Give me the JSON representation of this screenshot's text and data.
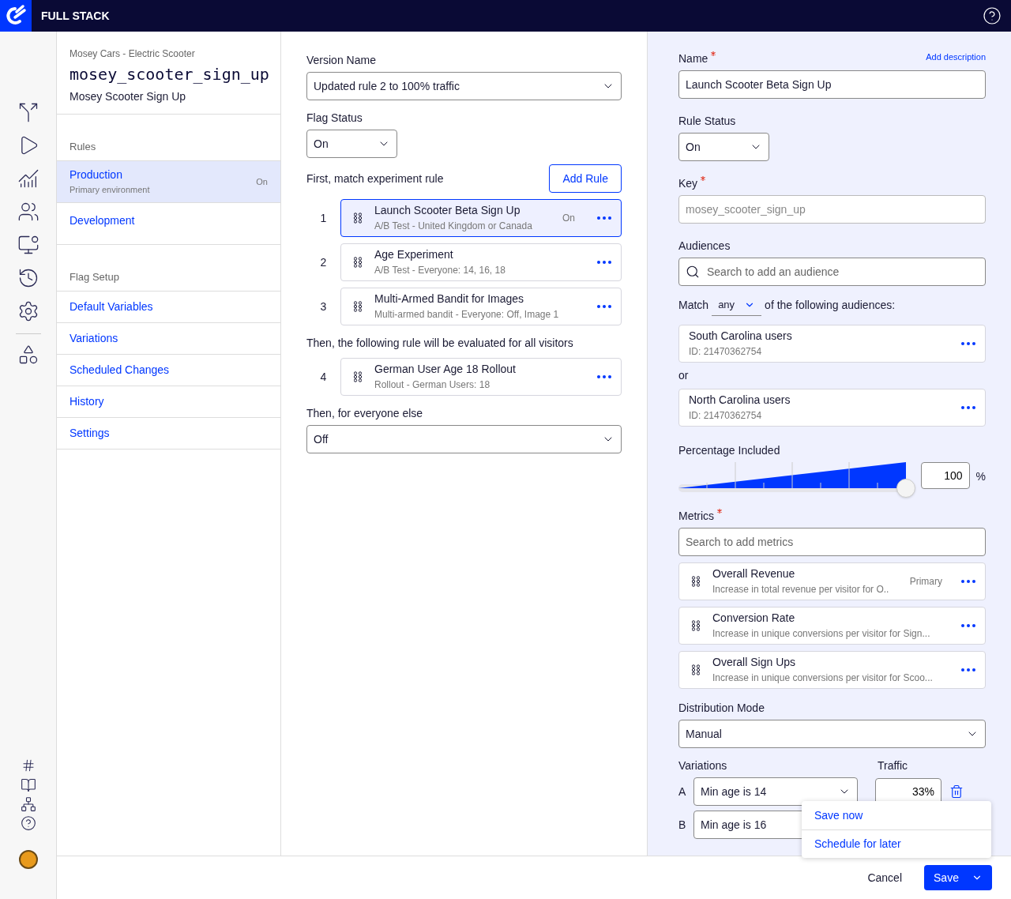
{
  "header": {
    "product": "FULL STACK"
  },
  "flag": {
    "project": "Mosey Cars - Electric Scooter",
    "key": "mosey_scooter_sign_up",
    "name": "Mosey Scooter Sign Up"
  },
  "sidebar": {
    "sections": [
      {
        "heading": "Rules",
        "items": [
          {
            "label": "Production",
            "sub": "Primary environment",
            "status": "On",
            "selected": true
          },
          {
            "label": "Development",
            "selected": false
          }
        ]
      },
      {
        "heading": "Flag Setup",
        "items": [
          {
            "label": "Default Variables",
            "selected": false
          },
          {
            "label": "Variations",
            "selected": false
          },
          {
            "label": "Scheduled Changes",
            "selected": false
          },
          {
            "label": "History",
            "selected": false
          },
          {
            "label": "Settings",
            "selected": false
          }
        ]
      }
    ]
  },
  "middle": {
    "version_name": {
      "label": "Version Name",
      "value": "Updated rule 2 to 100% traffic"
    },
    "flag_status": {
      "label": "Flag Status",
      "value": "On"
    },
    "first_match": {
      "label": "First, match experiment rule",
      "button": "Add Rule"
    },
    "rules": [
      {
        "number": "1",
        "title": "Launch Scooter Beta Sign Up",
        "subtitle": "A/B Test - United Kingdom or Canada",
        "status": "On",
        "selected": true
      },
      {
        "number": "2",
        "title": "Age Experiment",
        "subtitle": "A/B Test - Everyone: 14, 16, 18",
        "selected": false
      },
      {
        "number": "3",
        "title": "Multi-Armed Bandit for Images",
        "subtitle": "Multi-armed bandit - Everyone: Off, Image 1",
        "selected": false
      }
    ],
    "all_visitors_label": "Then, the following rule will be evaluated for all visitors",
    "rollout_rules": [
      {
        "number": "4",
        "title": "German User Age 18 Rollout",
        "subtitle": "Rollout - German Users: 18",
        "selected": false
      }
    ],
    "everyone_else": {
      "label": "Then, for everyone else",
      "value": "Off"
    }
  },
  "rule_panel": {
    "name": {
      "label": "Name",
      "required": true,
      "link": "Add description",
      "value": "Launch Scooter Beta Sign Up"
    },
    "rule_status": {
      "label": "Rule Status",
      "value": "On"
    },
    "key": {
      "label": "Key",
      "required": true,
      "value": "mosey_scooter_sign_up",
      "disabled": true
    },
    "audiences": {
      "label": "Audiences",
      "placeholder": "Search to add an audience"
    },
    "match": {
      "prefix": "Match",
      "value": "any",
      "suffix": "of the following audiences:"
    },
    "audience_items": [
      {
        "name": "South Carolina users",
        "id": "ID: 21470362754"
      },
      {
        "name": "North Carolina users",
        "id": "ID: 21470362754"
      }
    ],
    "audience_joiner": "or",
    "percentage": {
      "label": "Percentage Included",
      "level": 1,
      "value": "100",
      "unit": "%"
    },
    "metrics": {
      "label": "Metrics",
      "required": true,
      "placeholder": "Search to add metrics",
      "items": [
        {
          "name": "Overall Revenue",
          "description": "Increase in total revenue per visitor for O..",
          "tag": "Primary"
        },
        {
          "name": "Conversion Rate",
          "description": "Increase in unique conversions per visitor for Sign..."
        },
        {
          "name": "Overall Sign Ups",
          "description": "Increase in unique conversions per visitor for Scoo..."
        }
      ]
    },
    "distribution": {
      "label": "Distribution Mode",
      "value": "Manual"
    },
    "variations": {
      "label": "Variations",
      "traffic_label": "Traffic",
      "rows": [
        {
          "letter": "A",
          "value": "Min age is 14",
          "traffic": "33%"
        },
        {
          "letter": "B",
          "value": "Min age is 16"
        }
      ]
    }
  },
  "save_menu": [
    "Save now",
    "Schedule for later"
  ],
  "footer": {
    "cancel": "Cancel",
    "save": "Save"
  }
}
